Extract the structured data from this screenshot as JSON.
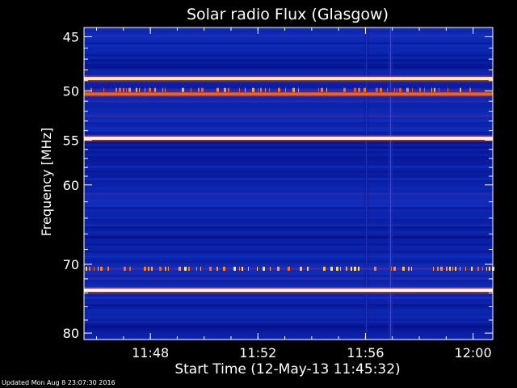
{
  "chart_data": {
    "type": "heatmap",
    "title": "Solar radio Flux (Glasgow)",
    "xlabel": "Start Time (12-May-13 11:45:32)",
    "ylabel": "Frequency [MHz]",
    "x_axis": {
      "start_time": "11:45:32",
      "end_time": "12:00:44",
      "range_minutes": [
        0.0,
        15.2
      ],
      "ticks": [
        {
          "label": "11:48",
          "minutes": 2.467
        },
        {
          "label": "11:52",
          "minutes": 6.467
        },
        {
          "label": "11:56",
          "minutes": 10.467
        },
        {
          "label": "12:00",
          "minutes": 14.467
        }
      ]
    },
    "y_axis": {
      "scale": "log",
      "reversed": true,
      "range_mhz": [
        44.2,
        81.0
      ],
      "major_ticks": [
        {
          "label": "45",
          "mhz": 45
        },
        {
          "label": "50",
          "mhz": 50
        },
        {
          "label": "55",
          "mhz": 55
        },
        {
          "label": "60",
          "mhz": 60
        },
        {
          "label": "70",
          "mhz": 70
        },
        {
          "label": "80",
          "mhz": 80
        }
      ],
      "minor_ticks_mhz": [
        46,
        47,
        48,
        49,
        51,
        52,
        53,
        54,
        56,
        57,
        58,
        59,
        62,
        64,
        66,
        68,
        72,
        74,
        76,
        78
      ]
    },
    "colormap": [
      "#00006a",
      "#1030c0",
      "#c02060",
      "#ff6000",
      "#ffe060",
      "#ffffe0"
    ],
    "background_level": 0.15,
    "continuous_bands": [
      {
        "mhz": 48.8,
        "intensity": 0.9
      },
      {
        "mhz": 50.3,
        "intensity": 0.6
      },
      {
        "mhz": 54.8,
        "intensity": 0.95
      },
      {
        "mhz": 73.6,
        "intensity": 1.0
      }
    ],
    "intermittent_bands": [
      {
        "mhz": 49.9,
        "intensity": 0.75
      },
      {
        "mhz": 70.6,
        "intensity": 0.85
      }
    ],
    "vertical_features": [
      {
        "minutes": 11.4,
        "intensity": 0.4
      },
      {
        "minutes": 10.5,
        "intensity": 0.25
      }
    ]
  },
  "footer": {
    "updated_text": "Updated Mon Aug  8 23:07:30 2016"
  }
}
